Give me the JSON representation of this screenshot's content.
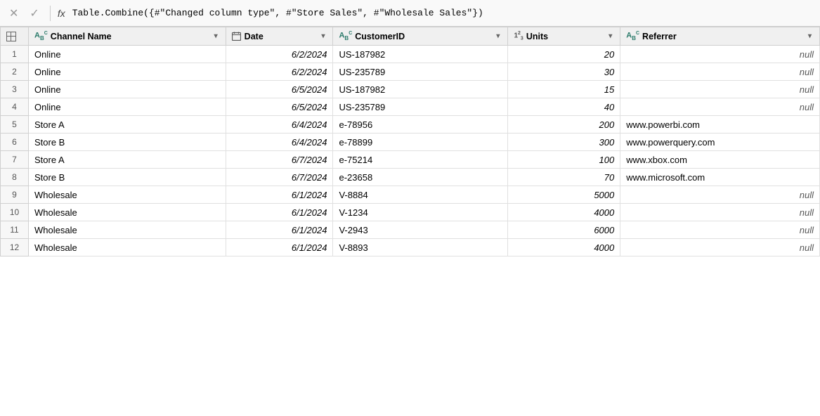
{
  "formula_bar": {
    "cancel_label": "✕",
    "confirm_label": "✓",
    "fx_label": "fx",
    "formula_value": "Table.Combine({#\"Changed column type\", #\"Store Sales\", #\"Wholesale Sales\"})"
  },
  "columns": [
    {
      "id": "channel_name",
      "type_icon": "ABC",
      "type": "abc",
      "name": "Channel Name",
      "has_dropdown": true
    },
    {
      "id": "date",
      "type_icon": "📅",
      "type": "date",
      "name": "Date",
      "has_dropdown": true
    },
    {
      "id": "customer_id",
      "type_icon": "ABC",
      "type": "abc",
      "name": "CustomerID",
      "has_dropdown": true
    },
    {
      "id": "units",
      "type_icon": "123",
      "type": "number",
      "name": "Units",
      "has_dropdown": true
    },
    {
      "id": "referrer",
      "type_icon": "ABC",
      "type": "abc",
      "name": "Referrer",
      "has_dropdown": true
    }
  ],
  "rows": [
    {
      "num": 1,
      "channel_name": "Online",
      "date": "6/2/2024",
      "customer_id": "US-187982",
      "units": "20",
      "referrer": "null"
    },
    {
      "num": 2,
      "channel_name": "Online",
      "date": "6/2/2024",
      "customer_id": "US-235789",
      "units": "30",
      "referrer": "null"
    },
    {
      "num": 3,
      "channel_name": "Online",
      "date": "6/5/2024",
      "customer_id": "US-187982",
      "units": "15",
      "referrer": "null"
    },
    {
      "num": 4,
      "channel_name": "Online",
      "date": "6/5/2024",
      "customer_id": "US-235789",
      "units": "40",
      "referrer": "null"
    },
    {
      "num": 5,
      "channel_name": "Store A",
      "date": "6/4/2024",
      "customer_id": "e-78956",
      "units": "200",
      "referrer": "www.powerbi.com"
    },
    {
      "num": 6,
      "channel_name": "Store B",
      "date": "6/4/2024",
      "customer_id": "e-78899",
      "units": "300",
      "referrer": "www.powerquery.com"
    },
    {
      "num": 7,
      "channel_name": "Store A",
      "date": "6/7/2024",
      "customer_id": "e-75214",
      "units": "100",
      "referrer": "www.xbox.com"
    },
    {
      "num": 8,
      "channel_name": "Store B",
      "date": "6/7/2024",
      "customer_id": "e-23658",
      "units": "70",
      "referrer": "www.microsoft.com"
    },
    {
      "num": 9,
      "channel_name": "Wholesale",
      "date": "6/1/2024",
      "customer_id": "V-8884",
      "units": "5000",
      "referrer": "null"
    },
    {
      "num": 10,
      "channel_name": "Wholesale",
      "date": "6/1/2024",
      "customer_id": "V-1234",
      "units": "4000",
      "referrer": "null"
    },
    {
      "num": 11,
      "channel_name": "Wholesale",
      "date": "6/1/2024",
      "customer_id": "V-2943",
      "units": "6000",
      "referrer": "null"
    },
    {
      "num": 12,
      "channel_name": "Wholesale",
      "date": "6/1/2024",
      "customer_id": "V-8893",
      "units": "4000",
      "referrer": "null"
    }
  ]
}
